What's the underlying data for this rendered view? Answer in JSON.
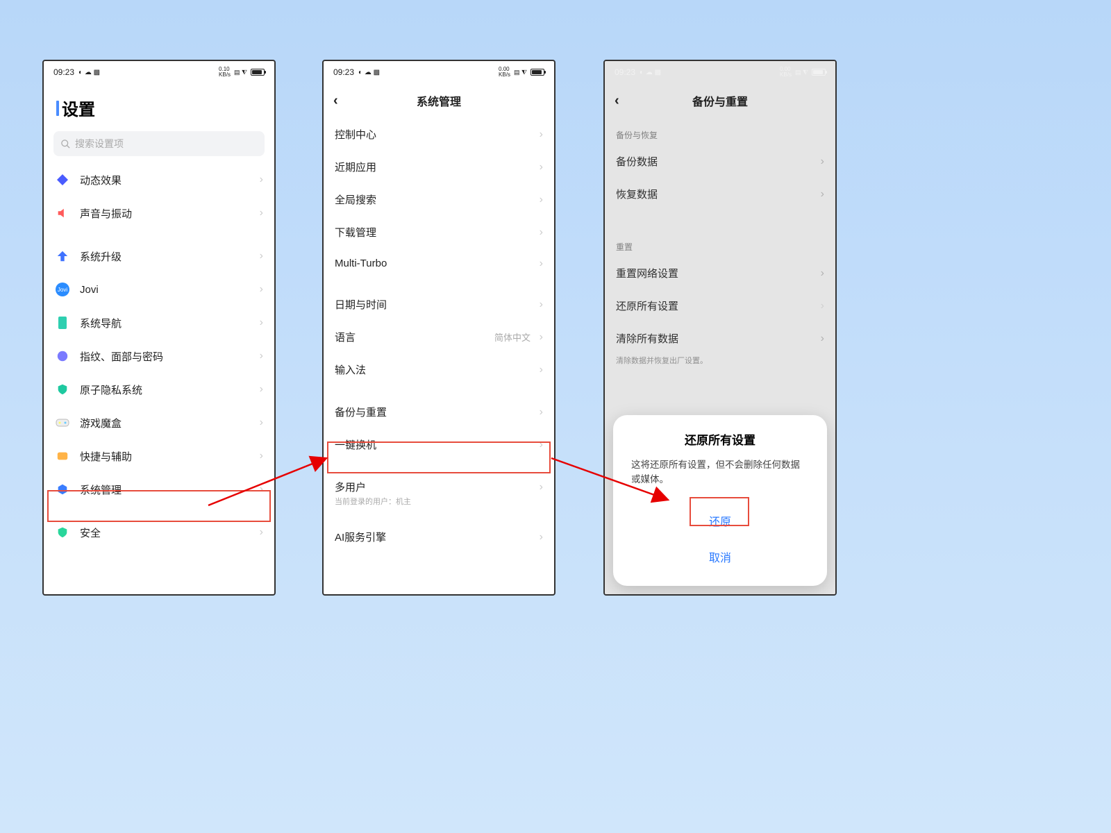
{
  "statusbar": {
    "time": "09:23",
    "net1": "0.10",
    "net2": "KB/s",
    "net3": "0.00"
  },
  "phone1": {
    "title": "设置",
    "search_placeholder": "搜索设置项",
    "items_a": [
      {
        "label": "动态效果"
      },
      {
        "label": "声音与振动"
      }
    ],
    "items_b": [
      {
        "label": "系统升级"
      },
      {
        "label": "Jovi"
      },
      {
        "label": "系统导航"
      },
      {
        "label": "指纹、面部与密码"
      },
      {
        "label": "原子隐私系统"
      },
      {
        "label": "游戏魔盒"
      },
      {
        "label": "快捷与辅助"
      },
      {
        "label": "系统管理"
      }
    ],
    "items_c": [
      {
        "label": "安全"
      }
    ]
  },
  "phone2": {
    "title": "系统管理",
    "group1": [
      {
        "label": "控制中心"
      },
      {
        "label": "近期应用"
      },
      {
        "label": "全局搜索"
      },
      {
        "label": "下载管理"
      },
      {
        "label": "Multi-Turbo"
      }
    ],
    "group2": [
      {
        "label": "日期与时间"
      },
      {
        "label": "语言",
        "right": "简体中文"
      },
      {
        "label": "输入法"
      }
    ],
    "group3": [
      {
        "label": "备份与重置"
      },
      {
        "label": "一键换机"
      }
    ],
    "group4": [
      {
        "label": "多用户",
        "sub": "当前登录的用户：机主"
      }
    ],
    "group5": [
      {
        "label": "AI服务引擎"
      }
    ]
  },
  "phone3": {
    "title": "备份与重置",
    "section_backup": "备份与恢复",
    "backup_items": [
      {
        "label": "备份数据"
      },
      {
        "label": "恢复数据"
      }
    ],
    "section_reset": "重置",
    "reset_items": [
      {
        "label": "重置网络设置"
      },
      {
        "label": "还原所有设置"
      },
      {
        "label": "清除所有数据"
      }
    ],
    "clear_desc": "清除数据并恢复出厂设置。",
    "dialog": {
      "title": "还原所有设置",
      "message": "这将还原所有设置，但不会删除任何数据或媒体。",
      "restore": "还原",
      "cancel": "取消"
    }
  }
}
